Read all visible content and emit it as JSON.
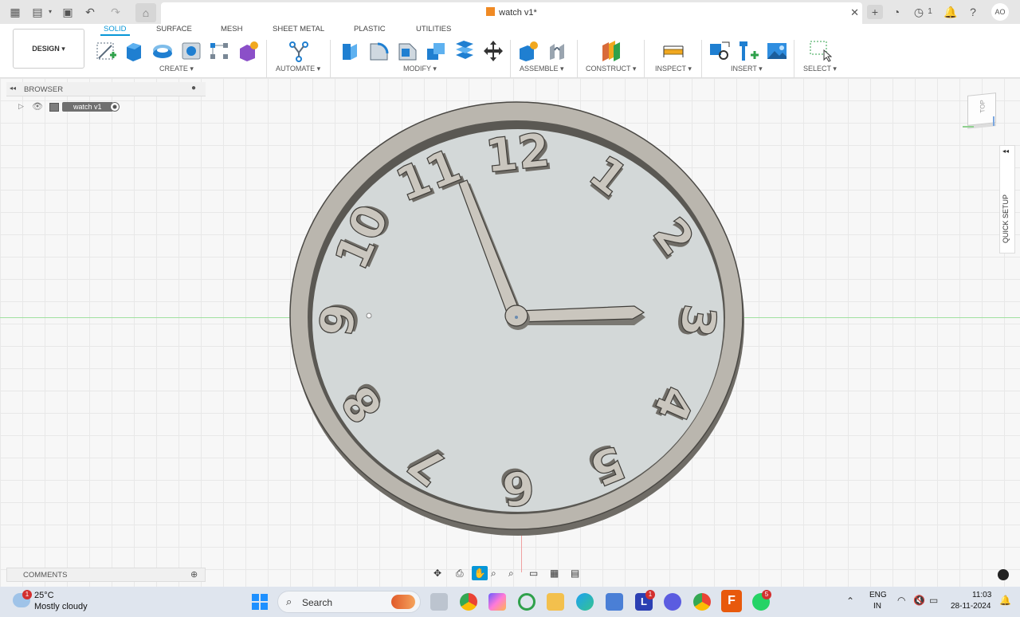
{
  "app": {
    "document_title": "watch v1*",
    "account_initials": "AO",
    "jobs_count": "1"
  },
  "toolbar": {
    "design_label": "DESIGN ▾",
    "tabs": [
      {
        "label": "SOLID",
        "active": true
      },
      {
        "label": "SURFACE",
        "active": false
      },
      {
        "label": "MESH",
        "active": false
      },
      {
        "label": "SHEET METAL",
        "active": false
      },
      {
        "label": "PLASTIC",
        "active": false
      },
      {
        "label": "UTILITIES",
        "active": false
      }
    ],
    "groups": {
      "create": "CREATE ▾",
      "automate": "AUTOMATE ▾",
      "modify": "MODIFY ▾",
      "assemble": "ASSEMBLE ▾",
      "construct": "CONSTRUCT ▾",
      "inspect": "INSPECT ▾",
      "insert": "INSERT ▾",
      "select": "SELECT ▾"
    }
  },
  "browser": {
    "title": "BROWSER",
    "root_item": "watch v1"
  },
  "comments": {
    "title": "COMMENTS"
  },
  "quick_setup": {
    "label": "QUICK SETUP"
  },
  "viewcube": {
    "face": "TOP"
  },
  "model": {
    "numerals": [
      "12",
      "1",
      "2",
      "3",
      "4",
      "5",
      "6",
      "7",
      "8",
      "9",
      "10",
      "11"
    ],
    "colors": {
      "dial": "#d3d8d8",
      "rim": "#bab6ae",
      "numeral_top": "#cac6be",
      "numeral_side": "#6f6c66"
    }
  },
  "taskbar": {
    "weather_temp": "25°C",
    "weather_desc": "Mostly cloudy",
    "weather_badge": "1",
    "search_placeholder": "Search",
    "teams_badge": "1",
    "whatsapp_badge": "5",
    "lang_line1": "ENG",
    "lang_line2": "IN",
    "time": "11:03",
    "date": "28-11-2024"
  }
}
